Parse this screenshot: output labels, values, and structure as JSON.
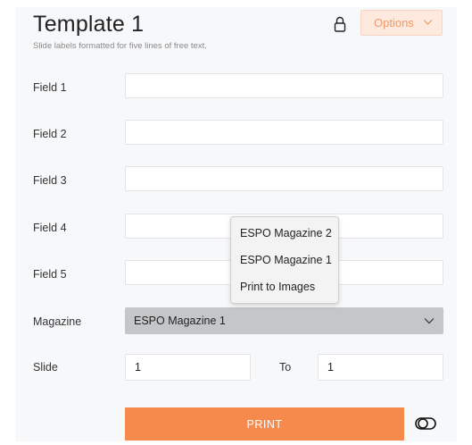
{
  "header": {
    "title": "Template 1",
    "subtitle": "Slide labels formatted for five lines of free text.",
    "options_label": "Options"
  },
  "fields": [
    {
      "label": "Field 1",
      "value": ""
    },
    {
      "label": "Field 2",
      "value": ""
    },
    {
      "label": "Field 3",
      "value": ""
    },
    {
      "label": "Field 4",
      "value": ""
    },
    {
      "label": "Field 5",
      "value": ""
    }
  ],
  "magazine": {
    "label": "Magazine",
    "selected": "ESPO Magazine 1",
    "options": [
      "ESPO Magazine 2",
      "ESPO Magazine 1",
      "Print to Images"
    ]
  },
  "slide": {
    "label": "Slide",
    "from_value": "1",
    "to_label": "To",
    "to_value": "1"
  },
  "print_label": "PRINT",
  "colors": {
    "accent": "#f58a4c",
    "options_bg": "#fde9dd",
    "options_text": "#f29a6b",
    "select_bg": "#c5c6c8"
  },
  "icons": [
    "lock-icon",
    "chevron-down-icon",
    "toggle-icon"
  ]
}
